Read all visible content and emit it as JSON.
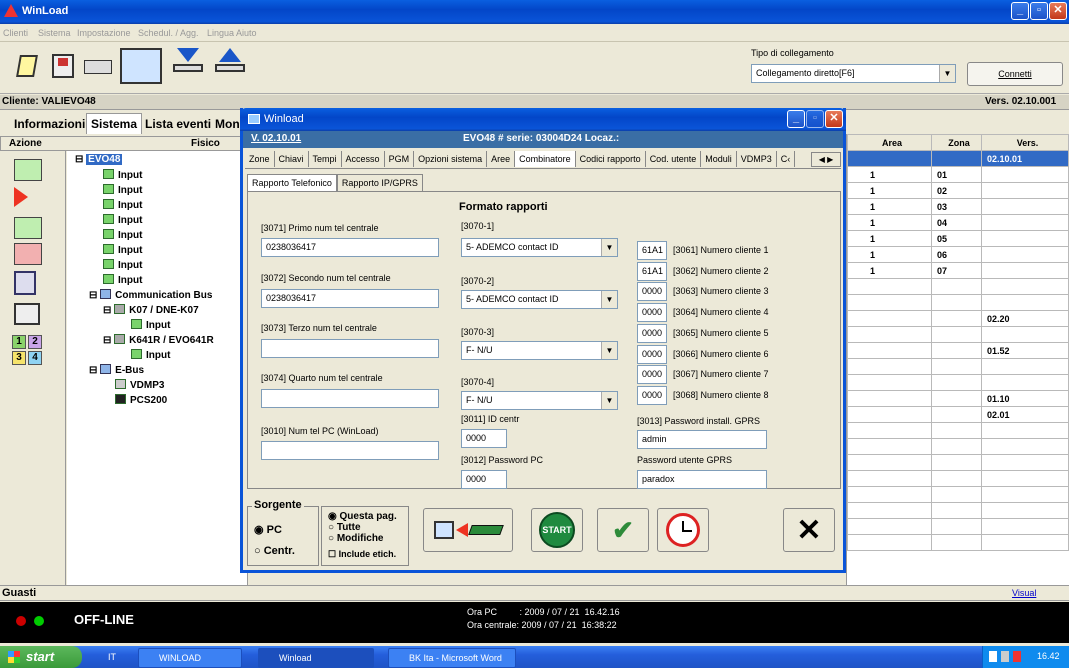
{
  "app": {
    "title": "WinLoad",
    "menu": [
      "Clienti",
      "Sistema",
      "Impostazione",
      "Schedul. / Agg.",
      "Lingua",
      "Aiuto"
    ]
  },
  "connection": {
    "label": "Tipo di collegamento",
    "value": "Collegamento diretto[F6]",
    "connect": "Connetti"
  },
  "client": {
    "label": "Cliente: VALIEVO48",
    "version": "Vers. 02.10.001"
  },
  "main_tabs": [
    "Informazioni",
    "Sistema",
    "Lista eventi",
    "Mon"
  ],
  "tree_headers": {
    "azione": "Azione",
    "fisico": "Fisico"
  },
  "tree": [
    {
      "label": "EVO48",
      "level": 0
    },
    {
      "label": "Input",
      "level": 1
    },
    {
      "label": "Input",
      "level": 1
    },
    {
      "label": "Input",
      "level": 1
    },
    {
      "label": "Input",
      "level": 1
    },
    {
      "label": "Input",
      "level": 1
    },
    {
      "label": "Input",
      "level": 1
    },
    {
      "label": "Input",
      "level": 1
    },
    {
      "label": "Input",
      "level": 1
    },
    {
      "label": "Communication Bus",
      "level": 0
    },
    {
      "label": "K07 / DNE-K07",
      "level": 1
    },
    {
      "label": "Input",
      "level": 2
    },
    {
      "label": "K641R / EVO641R",
      "level": 1
    },
    {
      "label": "Input",
      "level": 2
    },
    {
      "label": "E-Bus",
      "level": 0
    },
    {
      "label": "VDMP3",
      "level": 1
    },
    {
      "label": "PCS200",
      "level": 1
    }
  ],
  "zone_buttons": [
    "1",
    "2",
    "3",
    "4"
  ],
  "grid": {
    "headers": [
      "Area",
      "Zona",
      "Vers."
    ],
    "rows": [
      [
        "",
        "",
        "02.10.01"
      ],
      [
        "1",
        "01",
        ""
      ],
      [
        "1",
        "02",
        ""
      ],
      [
        "1",
        "03",
        ""
      ],
      [
        "1",
        "04",
        ""
      ],
      [
        "1",
        "05",
        ""
      ],
      [
        "1",
        "06",
        ""
      ],
      [
        "1",
        "07",
        ""
      ],
      [
        "",
        "",
        ""
      ],
      [
        "",
        "",
        ""
      ],
      [
        "",
        "",
        "02.20"
      ],
      [
        "",
        "",
        ""
      ],
      [
        "",
        "",
        "01.52"
      ],
      [
        "",
        "",
        ""
      ],
      [
        "",
        "",
        ""
      ],
      [
        "",
        "",
        "01.10"
      ],
      [
        "",
        "",
        "02.01"
      ],
      [
        "",
        "",
        ""
      ],
      [
        "",
        "",
        ""
      ],
      [
        "",
        "",
        ""
      ],
      [
        "",
        "",
        ""
      ],
      [
        "",
        "",
        ""
      ],
      [
        "",
        "",
        ""
      ],
      [
        "",
        "",
        ""
      ],
      [
        "",
        "",
        ""
      ]
    ]
  },
  "dialog": {
    "title": "Winload",
    "version": "V. 02.10.01",
    "serial": "EVO48  # serie: 03004D24 Locaz.:",
    "tabs": [
      "Zone",
      "Chiavi",
      "Tempi",
      "Accesso",
      "PGM",
      "Opzioni sistema",
      "Aree",
      "Combinatore",
      "Codici rapporto",
      "Cod. utente",
      "Moduli",
      "VDMP3",
      "C‹"
    ],
    "subtabs": [
      "Rapporto Telefonico",
      "Rapporto IP/GPRS"
    ],
    "format_title": "Formato rapporti",
    "phones": [
      {
        "label": "[3071] Primo num tel centrale",
        "value": "0238036417"
      },
      {
        "label": "[3072] Secondo num tel centrale",
        "value": "0238036417"
      },
      {
        "label": "[3073] Terzo num tel centrale",
        "value": ""
      },
      {
        "label": "[3074] Quarto num tel centrale",
        "value": ""
      },
      {
        "label": "[3010] Num tel PC (WinLoad)",
        "value": ""
      }
    ],
    "formats": [
      {
        "label": "[3070-1]",
        "value": "5- ADEMCO contact ID"
      },
      {
        "label": "[3070-2]",
        "value": "5- ADEMCO contact ID"
      },
      {
        "label": "[3070-3]",
        "value": "F- N/U"
      },
      {
        "label": "[3070-4]",
        "value": "F- N/U"
      }
    ],
    "id_centr": {
      "label": "[3011] ID centr",
      "value": "0000"
    },
    "pc_pass": {
      "label": "[3012] Password PC",
      "value": "0000"
    },
    "clients": [
      {
        "value": "61A1",
        "label": "[3061] Numero cliente  1"
      },
      {
        "value": "61A1",
        "label": "[3062] Numero cliente  2"
      },
      {
        "value": "0000",
        "label": "[3063] Numero cliente  3"
      },
      {
        "value": "0000",
        "label": "[3064] Numero cliente  4"
      },
      {
        "value": "0000",
        "label": "[3065] Numero cliente  5"
      },
      {
        "value": "0000",
        "label": "[3066] Numero cliente  6"
      },
      {
        "value": "0000",
        "label": "[3067] Numero cliente  7"
      },
      {
        "value": "0000",
        "label": "[3068] Numero cliente  8"
      }
    ],
    "gprs_install": {
      "label": "[3013] Password install. GPRS",
      "value": "admin"
    },
    "gprs_user": {
      "label": "Password utente GPRS",
      "value": "paradox"
    },
    "source": {
      "title": "Sorgente",
      "pc": "PC",
      "centr": "Centr."
    },
    "scope": {
      "this": "Questa pag.",
      "all": "Tutte",
      "changes": "Modifiche",
      "labels": "Include etich."
    },
    "start": "START"
  },
  "faults": {
    "label": "Guasti",
    "visual": "Visual"
  },
  "status": {
    "offline": "OFF-LINE",
    "pc_time": "Ora PC         : 2009 / 07 / 21  16.42.16",
    "panel_time": "Ora centrale: 2009 / 07 / 21  16:38:22"
  },
  "taskbar": {
    "start": "start",
    "items": [
      "IT",
      "WINLOAD",
      "Winload",
      "BK Ita - Microsoft Word"
    ],
    "clock": "16.42"
  },
  "colors": {
    "accent": "#0a246a",
    "selection": "#316ac5",
    "xp_blue": "#245edb"
  }
}
